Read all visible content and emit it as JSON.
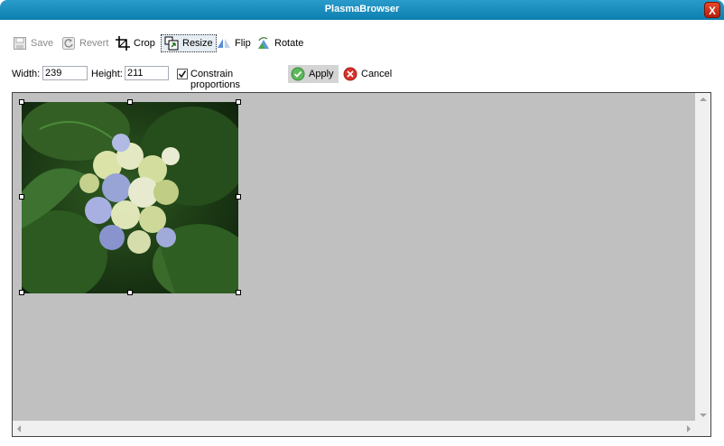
{
  "window": {
    "title": "PlasmaBrowser",
    "close_label": "X"
  },
  "toolbar": {
    "save": "Save",
    "revert": "Revert",
    "crop": "Crop",
    "resize": "Resize",
    "flip": "Flip",
    "rotate": "Rotate"
  },
  "resize_panel": {
    "width_label": "Width:",
    "width_value": "239",
    "height_label": "Height:",
    "height_value": "211",
    "constrain_label": "Constrain proportions",
    "constrain_checked": true,
    "apply_label": "Apply",
    "cancel_label": "Cancel"
  },
  "colors": {
    "titlebar": "#0d7fb0",
    "canvas_bg": "#c0c0c0",
    "apply_bg": "#d4d4d4"
  }
}
